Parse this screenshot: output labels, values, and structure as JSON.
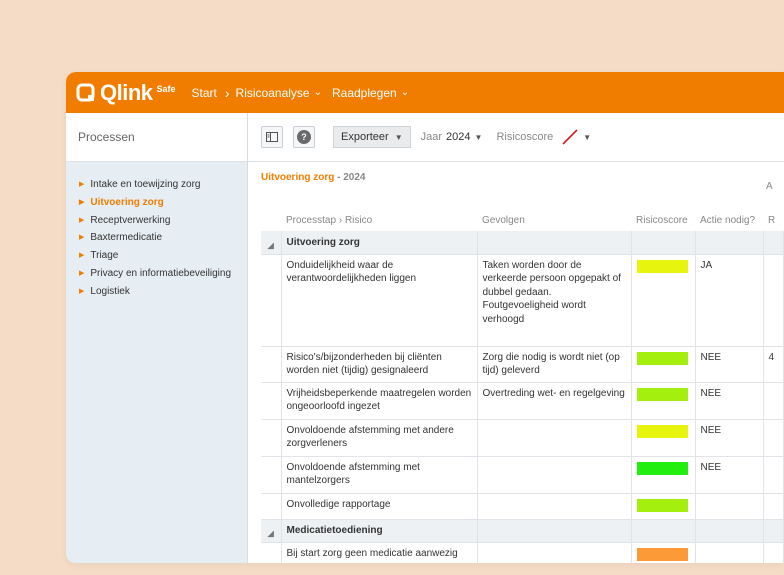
{
  "app": {
    "brand": "Qlink",
    "brand_sup": "Safe",
    "nav": [
      {
        "label": "Start"
      },
      {
        "label": "Risicoanalyse"
      },
      {
        "label": "Raadplegen"
      }
    ],
    "accent": "#f07d00"
  },
  "sidebar": {
    "title": "Processen",
    "items": [
      {
        "label": "Intake en toewijzing zorg"
      },
      {
        "label": "Uitvoering zorg"
      },
      {
        "label": "Receptverwerking"
      },
      {
        "label": "Baxtermedicatie"
      },
      {
        "label": "Triage"
      },
      {
        "label": "Privacy en informatiebeveiliging"
      },
      {
        "label": "Logistiek"
      }
    ],
    "active_index": 1
  },
  "toolbar": {
    "export_label": "Exporteer",
    "year_label": "Jaar",
    "year_value": "2024",
    "score_label": "Risicoscore"
  },
  "content": {
    "title": "Uitvoering zorg",
    "year": "- 2024",
    "cut_right": "A",
    "columns": {
      "processtap": "Processtap",
      "risico": "Risico",
      "gevolgen": "Gevolgen",
      "risicoscore": "Risicoscore",
      "actie": "Actie nodig?",
      "extra": "R"
    },
    "groups": [
      {
        "label": "Uitvoering zorg",
        "rows": [
          {
            "risico": "Onduidelijkheid waar de verantwoordelijkheden liggen",
            "gevolgen": "Taken worden door de verkeerde persoon opgepakt of dubbel gedaan. Foutgevoeligheid wordt verhoogd",
            "color": "#e7f50e",
            "actie": "JA",
            "extra": ""
          },
          {
            "risico": "Risico's/bijzonderheden bij cliënten worden niet (tijdig) gesignaleerd",
            "gevolgen": "Zorg die nodig is wordt niet (op tijd) geleverd",
            "color": "#a4ef0d",
            "actie": "NEE",
            "extra": "4"
          },
          {
            "risico": "Vrijheidsbeperkende maatregelen worden ongeoorloofd ingezet",
            "gevolgen": "Overtreding wet- en regelgeving",
            "color": "#a4ef0d",
            "actie": "NEE",
            "extra": ""
          },
          {
            "risico": "Onvoldoende afstemming met andere zorgverleners",
            "gevolgen": "",
            "color": "#e7f50e",
            "actie": "NEE",
            "extra": ""
          },
          {
            "risico": "Onvoldoende afstemming met mantelzorgers",
            "gevolgen": "",
            "color": "#22ee0f",
            "actie": "NEE",
            "extra": ""
          },
          {
            "risico": "Onvolledige rapportage",
            "gevolgen": "",
            "color": "#a4ef0d",
            "actie": "",
            "extra": ""
          }
        ]
      },
      {
        "label": "Medicatietoediening",
        "rows": [
          {
            "risico": "Bij start zorg geen medicatie aanwezig",
            "gevolgen": "",
            "color": "#fb9a36",
            "actie": "",
            "extra": ""
          }
        ]
      }
    ]
  }
}
